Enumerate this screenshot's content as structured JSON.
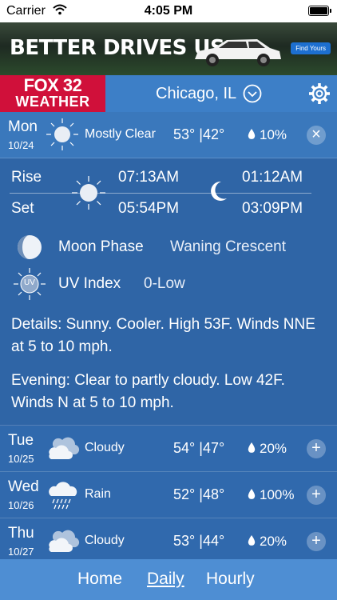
{
  "status_bar": {
    "carrier": "Carrier",
    "time": "4:05 PM"
  },
  "ad": {
    "headline": "BETTER DRIVES US.",
    "cta": "Find Yours"
  },
  "header": {
    "logo_line1": "FOX 32",
    "logo_line2": "WEATHER",
    "location": "Chicago, IL"
  },
  "today": {
    "day": "Mon",
    "date": "10/24",
    "icon": "sun-icon",
    "condition": "Mostly Clear",
    "high": "53°",
    "separator": "|",
    "low": "42°",
    "precip": "10%",
    "action": "×",
    "sun": {
      "rise_label": "Rise",
      "set_label": "Set",
      "sunrise": "07:13AM",
      "sunset": "05:54PM",
      "moonrise": "01:12AM",
      "moonset": "03:09PM"
    },
    "moon_phase_label": "Moon Phase",
    "moon_phase_value": "Waning Crescent",
    "uv_icon_text": "UV",
    "uv_label": "UV Index",
    "uv_value": "0-Low",
    "details": "Details: Sunny. Cooler. High 53F. Winds NNE at 5 to 10 mph.",
    "evening": "Evening: Clear to partly cloudy. Low 42F. Winds N at 5 to 10 mph."
  },
  "forecast": [
    {
      "day": "Tue",
      "date": "10/25",
      "icon": "cloudy-icon",
      "condition": "Cloudy",
      "high": "54°",
      "low": "47°",
      "precip": "20%",
      "action": "+"
    },
    {
      "day": "Wed",
      "date": "10/26",
      "icon": "rain-icon",
      "condition": "Rain",
      "high": "52°",
      "low": "48°",
      "precip": "100%",
      "action": "+"
    },
    {
      "day": "Thu",
      "date": "10/27",
      "icon": "cloudy-icon",
      "condition": "Cloudy",
      "high": "53°",
      "low": "44°",
      "precip": "20%",
      "action": "+"
    }
  ],
  "tabs": [
    "Home",
    "Daily",
    "Hourly"
  ],
  "active_tab": "Daily",
  "colors": {
    "background": "#2d5f9e",
    "header": "#3d7fc7",
    "logo_red": "#d0103a",
    "tabbar": "#4e8ed3"
  }
}
